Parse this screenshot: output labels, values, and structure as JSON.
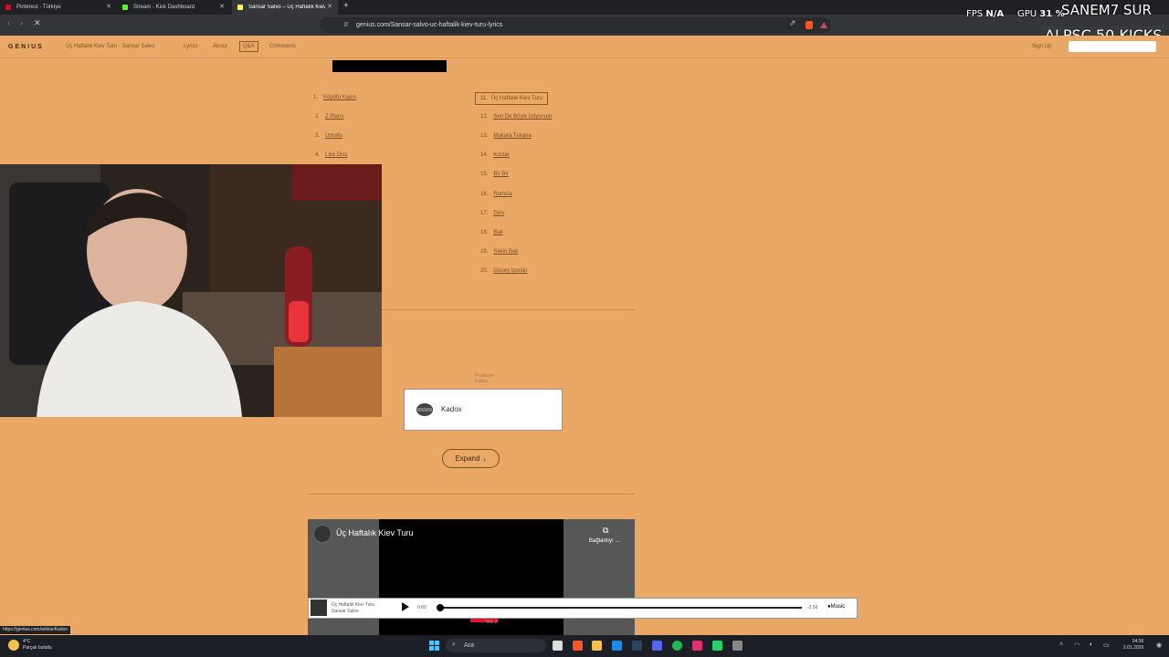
{
  "tabs": [
    {
      "label": "Pinterest - Türkiye"
    },
    {
      "label": "Stream - Kick Dashboard"
    },
    {
      "label": "Sansar Salvo – Üç Haftalık Kiev T"
    }
  ],
  "address": {
    "url": "genius.com/Sansar-salvo-uc-haftalik-kiev-turu-lyrics"
  },
  "overlay": {
    "fps_label": "FPS",
    "fps_value": "N/A",
    "gpu_label": "GPU",
    "gpu_value": "31 %",
    "name_line": "SANEM7 SUR",
    "kicks_line": "ALPSC 50 KICKS"
  },
  "genius_header": {
    "logo": "GENIUS",
    "song": "Üç Haftalık Kiev Turu · Sansar Salvo",
    "nav": [
      "Lyrics",
      "About",
      "Q&A",
      "Comments"
    ],
    "signup": "Sign Up"
  },
  "tracklist_left": [
    {
      "num": "1.",
      "title": "Köpötü Kayın"
    },
    {
      "num": "2.",
      "title": "Z Plans"
    },
    {
      "num": "3.",
      "title": "Umutlu"
    },
    {
      "num": "4.",
      "title": "Like Diss"
    }
  ],
  "tracklist_right": [
    {
      "num": "11.",
      "title": "Üç Haftalık Kiev Turu",
      "current": true
    },
    {
      "num": "12.",
      "title": "Sen De Böyle İstiyorsun"
    },
    {
      "num": "13.",
      "title": "Makara Tukana"
    },
    {
      "num": "14.",
      "title": "Kostar"
    },
    {
      "num": "15.",
      "title": "Bir Bir"
    },
    {
      "num": "16.",
      "title": "Ramcia"
    },
    {
      "num": "17.",
      "title": "Diriv"
    },
    {
      "num": "18.",
      "title": "Bak"
    },
    {
      "num": "19.",
      "title": "Sakin Bak"
    },
    {
      "num": "20.",
      "title": "Güneş Ipsılan"
    }
  ],
  "credits": {
    "producer_label": "Producer",
    "producer_small": "Kadox",
    "card_name": "Kadox",
    "expand_label": "Expand"
  },
  "video": {
    "title": "Üç Haftalık Kiev Turu",
    "copy_label": "Bağlantıyı ..."
  },
  "player": {
    "track": "Üç Haftalık Kiev Turu",
    "artist": "Sansar Salvo",
    "time_current": "0:00",
    "time_remaining": "-2:56",
    "service": "Music",
    "extra": "Vol. 2"
  },
  "status_url": "https://genius.com/artists/Kadox",
  "taskbar": {
    "weather_temp": "4°C",
    "weather_desc": "Parçalı bulutlu",
    "search": "Ara",
    "time": "04:36",
    "date": "2.01.2026"
  }
}
